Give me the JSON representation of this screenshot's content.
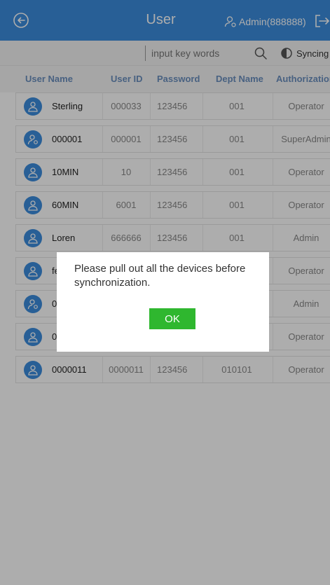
{
  "header": {
    "title": "User",
    "admin_label": "Admin(888888)",
    "icons": [
      "back-icon",
      "admin-user-icon",
      "logout-icon"
    ]
  },
  "search": {
    "placeholder": "input key words",
    "sync_label": "Syncing"
  },
  "columns": [
    "User Name",
    "User ID",
    "Password",
    "Dept Name",
    "Authorization"
  ],
  "rows": [
    {
      "name": "Sterling",
      "user_id": "000033",
      "password": "123456",
      "dept": "001",
      "auth": "Operator"
    },
    {
      "name": "000001",
      "user_id": "000001",
      "password": "123456",
      "dept": "001",
      "auth": "SuperAdmin"
    },
    {
      "name": "10MIN",
      "user_id": "10",
      "password": "123456",
      "dept": "001",
      "auth": "Operator"
    },
    {
      "name": "60MIN",
      "user_id": "6001",
      "password": "123456",
      "dept": "001",
      "auth": "Operator"
    },
    {
      "name": "Loren",
      "user_id": "666666",
      "password": "123456",
      "dept": "001",
      "auth": "Admin"
    },
    {
      "name": "fe",
      "user_id": "",
      "password": "",
      "dept": "",
      "auth": "Operator"
    },
    {
      "name": "0",
      "user_id": "",
      "password": "",
      "dept": "",
      "auth": "Admin"
    },
    {
      "name": "0",
      "user_id": "",
      "password": "",
      "dept": "",
      "auth": "Operator"
    },
    {
      "name": "0000011",
      "user_id": "0000011",
      "password": "123456",
      "dept": "010101",
      "auth": "Operator"
    }
  ],
  "dialog": {
    "message": "Please pull out all the devices before synchronization.",
    "ok_label": "OK"
  },
  "colors": {
    "header_bg": "#3c8dde",
    "column_header_text": "#6a8fbf",
    "ok_button": "#2fb72f"
  }
}
